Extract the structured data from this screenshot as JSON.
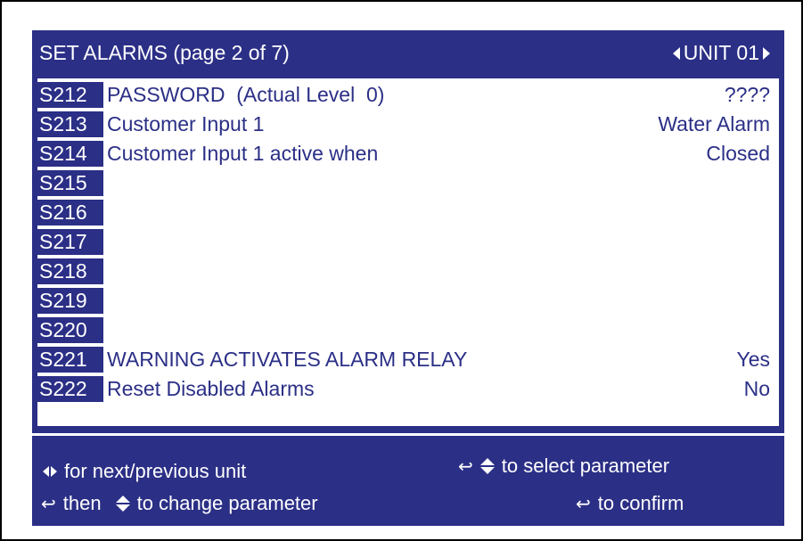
{
  "header": {
    "title": "SET ALARMS (page 2 of 7)",
    "unit": "UNIT 01"
  },
  "rows": [
    {
      "code": "S212",
      "label": "PASSWORD  (Actual Level  0)",
      "value": "????"
    },
    {
      "code": "S213",
      "label": "Customer Input 1",
      "value": "Water Alarm"
    },
    {
      "code": "S214",
      "label": "Customer Input 1 active when",
      "value": "Closed"
    },
    {
      "code": "S215",
      "label": "",
      "value": ""
    },
    {
      "code": "S216",
      "label": "",
      "value": ""
    },
    {
      "code": "S217",
      "label": "",
      "value": ""
    },
    {
      "code": "S218",
      "label": "",
      "value": ""
    },
    {
      "code": "S219",
      "label": "",
      "value": ""
    },
    {
      "code": "S220",
      "label": "",
      "value": ""
    },
    {
      "code": "S221",
      "label": "WARNING ACTIVATES ALARM RELAY",
      "value": "Yes"
    },
    {
      "code": "S222",
      "label": "Reset Disabled Alarms",
      "value": "No"
    }
  ],
  "help": {
    "next_prev": "for next/previous unit",
    "select_param": "to select parameter",
    "then": "then",
    "change_param": "to change parameter",
    "confirm": "to confirm"
  },
  "icons": {
    "unit_nav": "left-right-arrows-icon",
    "enter": "enter-icon",
    "up_down": "up-down-arrows-icon"
  },
  "colors": {
    "screen_bg": "#2b2f86",
    "panel_bg": "#ffffff",
    "text_on_dark": "#ffffff",
    "text_on_light": "#2b2f86"
  }
}
